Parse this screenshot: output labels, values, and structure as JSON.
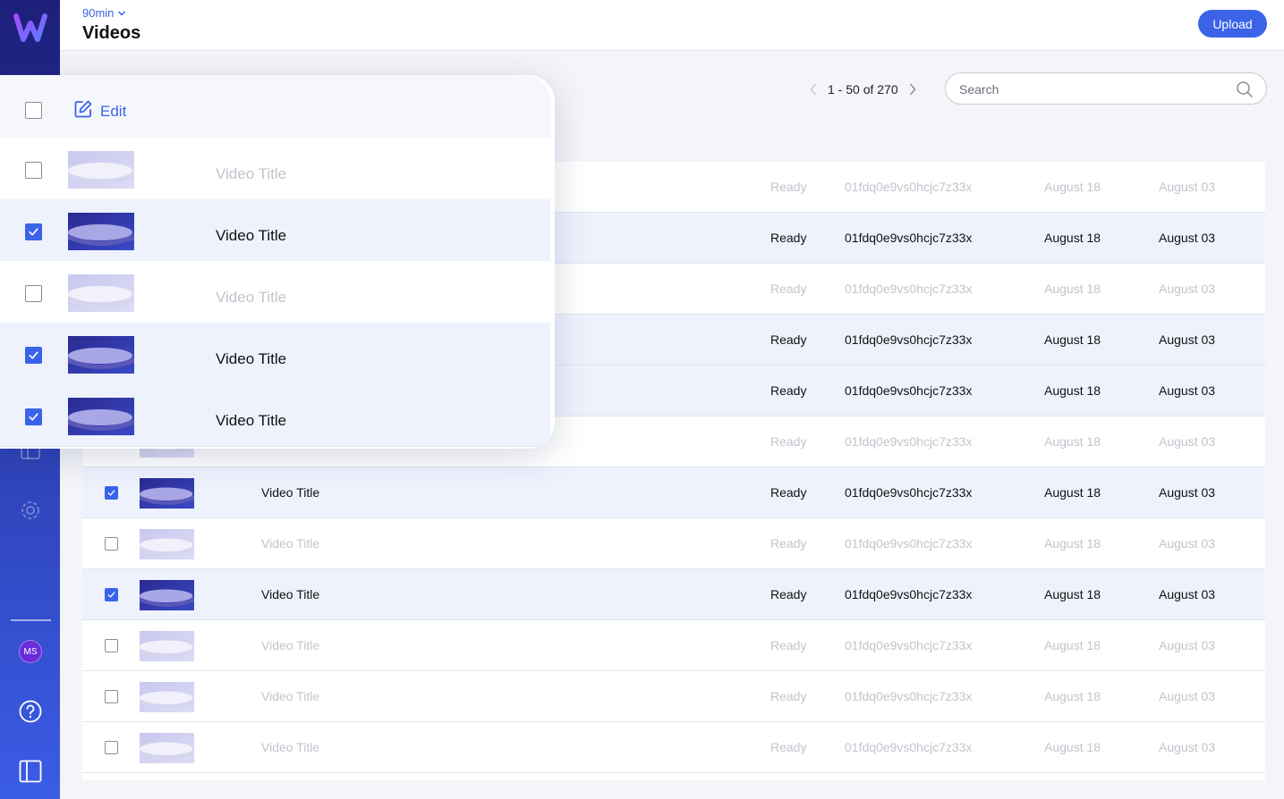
{
  "header": {
    "project": "90min",
    "title": "Videos",
    "upload_label": "Upload"
  },
  "pager": {
    "label": "1 - 50 of 270"
  },
  "search": {
    "placeholder": "Search"
  },
  "sidebar": {
    "avatar_initials": "MS"
  },
  "overlay": {
    "edit_label": "Edit",
    "rows": [
      {
        "title": "Video Title",
        "selected": false
      },
      {
        "title": "Video Title",
        "selected": true
      },
      {
        "title": "Video Title",
        "selected": false
      },
      {
        "title": "Video Title",
        "selected": true
      },
      {
        "title": "Video Title",
        "selected": true
      }
    ]
  },
  "table": {
    "rows": [
      {
        "title": "Video Title",
        "status": "Ready",
        "id": "01fdq0e9vs0hcjc7z33x",
        "created": "August 18",
        "updated": "August 03",
        "selected": false
      },
      {
        "title": "Video Title",
        "status": "Ready",
        "id": "01fdq0e9vs0hcjc7z33x",
        "created": "August 18",
        "updated": "August 03",
        "selected": true
      },
      {
        "title": "Video Title",
        "status": "Ready",
        "id": "01fdq0e9vs0hcjc7z33x",
        "created": "August 18",
        "updated": "August 03",
        "selected": false
      },
      {
        "title": "Video Title",
        "status": "Ready",
        "id": "01fdq0e9vs0hcjc7z33x",
        "created": "August 18",
        "updated": "August 03",
        "selected": true
      },
      {
        "title": "Video Title",
        "status": "Ready",
        "id": "01fdq0e9vs0hcjc7z33x",
        "created": "August 18",
        "updated": "August 03",
        "selected": true
      },
      {
        "title": "Video Title",
        "status": "Ready",
        "id": "01fdq0e9vs0hcjc7z33x",
        "created": "August 18",
        "updated": "August 03",
        "selected": false
      },
      {
        "title": "Video Title",
        "status": "Ready",
        "id": "01fdq0e9vs0hcjc7z33x",
        "created": "August 18",
        "updated": "August 03",
        "selected": true
      },
      {
        "title": "Video Title",
        "status": "Ready",
        "id": "01fdq0e9vs0hcjc7z33x",
        "created": "August 18",
        "updated": "August 03",
        "selected": false
      },
      {
        "title": "Video Title",
        "status": "Ready",
        "id": "01fdq0e9vs0hcjc7z33x",
        "created": "August 18",
        "updated": "August 03",
        "selected": true
      },
      {
        "title": "Video Title",
        "status": "Ready",
        "id": "01fdq0e9vs0hcjc7z33x",
        "created": "August 18",
        "updated": "August 03",
        "selected": false
      },
      {
        "title": "Video Title",
        "status": "Ready",
        "id": "01fdq0e9vs0hcjc7z33x",
        "created": "August 18",
        "updated": "August 03",
        "selected": false
      },
      {
        "title": "Video Title",
        "status": "Ready",
        "id": "01fdq0e9vs0hcjc7z33x",
        "created": "August 18",
        "updated": "August 03",
        "selected": false
      }
    ]
  },
  "icons": {
    "logo": "logo-icon",
    "settings": "gear-icon",
    "library": "library-icon",
    "help": "help-icon",
    "panel": "panel-toggle-icon",
    "search": "search-icon",
    "edit": "edit-icon"
  },
  "colors": {
    "accent": "#3b63e8",
    "selected_row": "#eef2fd",
    "sidebar_top": "#1d1f7a",
    "sidebar_bottom": "#3b5ce6"
  }
}
